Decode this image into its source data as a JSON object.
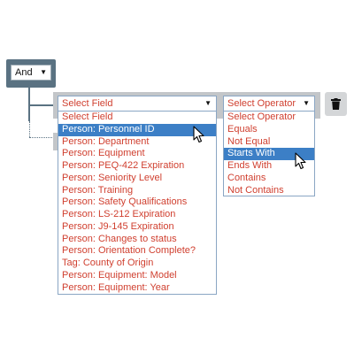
{
  "group": {
    "operator_label": "And"
  },
  "field_select": {
    "value": "Select Field",
    "options": [
      "Select Field",
      "Person: Personnel ID",
      "Person: Department",
      "Person: Equipment",
      "Person: PEQ-422 Expiration",
      "Person: Seniority Level",
      "Person: Training",
      "Person: Safety Qualifications",
      "Person: LS-212 Expiration",
      "Person: J9-145 Expiration",
      "Person: Changes to status",
      "Person: Orientation Complete?",
      "Tag: County of Origin",
      "Person: Equipment: Model",
      "Person: Equipment: Year"
    ],
    "highlighted_index": 1
  },
  "operator_select": {
    "value": "Select Operator",
    "options": [
      "Select Operator",
      "Equals",
      "Not Equal",
      "Starts With",
      "Ends With",
      "Contains",
      "Not Contains"
    ],
    "highlighted_index": 3
  },
  "icons": {
    "delete": "trash-icon",
    "cursor": "mouse-pointer-icon",
    "dropdown_arrow": "caret-down-icon"
  },
  "colors": {
    "group_bg": "#5a7282",
    "option_text": "#d04030",
    "highlight": "#3c7fc6",
    "rule_row": "#c3c6c9"
  }
}
